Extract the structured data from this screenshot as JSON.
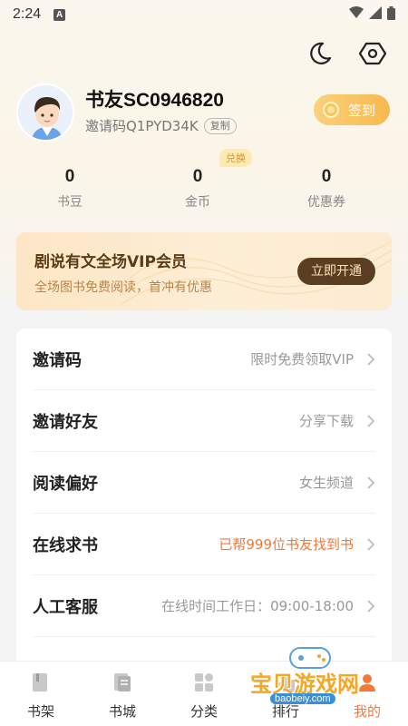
{
  "status_bar": {
    "time": "2:24",
    "notification_icon": "A"
  },
  "header": {
    "night_mode_icon": "moon-icon",
    "settings_icon": "settings-hex-icon"
  },
  "profile": {
    "username": "书友SC0946820",
    "invite_code": "邀请码Q1PYD34K",
    "copy_label": "复制",
    "checkin_label": "签到"
  },
  "stats": {
    "exchange_badge": "兑换",
    "items": [
      {
        "value": "0",
        "label": "书豆"
      },
      {
        "value": "0",
        "label": "金币"
      },
      {
        "value": "0",
        "label": "优惠券"
      }
    ]
  },
  "vip": {
    "title": "剧说有文全场VIP会员",
    "subtitle": "全场图书免费阅读，首冲有优惠",
    "button": "立即开通"
  },
  "menu": [
    {
      "label": "邀请码",
      "value": "限时免费领取VIP",
      "highlight": false
    },
    {
      "label": "邀请好友",
      "value": "分享下载",
      "highlight": false
    },
    {
      "label": "阅读偏好",
      "value": "女生频道",
      "highlight": false
    },
    {
      "label": "在线求书",
      "value": "已帮999位书友找到书",
      "highlight": true
    },
    {
      "label": "人工客服",
      "value": "在线时间工作日：09:00-18:00",
      "highlight": false
    }
  ],
  "tabbar": [
    {
      "label": "书架",
      "icon": "bookshelf-icon"
    },
    {
      "label": "书城",
      "icon": "bookstore-icon"
    },
    {
      "label": "分类",
      "icon": "category-grid-icon"
    },
    {
      "label": "排行",
      "icon": "ranking-icon"
    },
    {
      "label": "我的",
      "icon": "profile-icon"
    }
  ],
  "watermark": {
    "text": "宝贝游戏网",
    "url": "baobeiy.com"
  },
  "colors": {
    "accent_orange": "#f07a3a",
    "vip_button": "#5a3e22",
    "checkin_gold": "#f7b94e"
  }
}
